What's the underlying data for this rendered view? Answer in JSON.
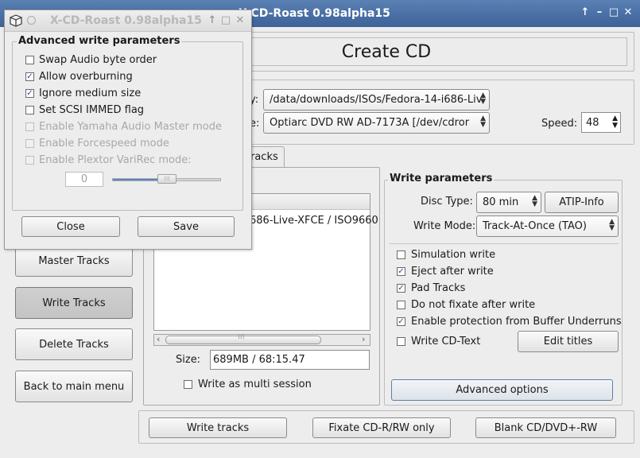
{
  "main_window": {
    "title": "X-CD-Roast 0.98alpha15",
    "controls": [
      "↑",
      "–",
      "□",
      "✕"
    ]
  },
  "header": {
    "title": "Create CD"
  },
  "device": {
    "image_path": "/data/downloads/ISOs/Fedora-14-i686-Liv",
    "image_label_tail": "y:",
    "writer": "Optiarc  DVD RW AD-7173A  [/dev/cdror",
    "writer_label_tail": "e:",
    "speed_label": "Speed:",
    "speed_value": "48"
  },
  "tab": {
    "label_tail": "racks"
  },
  "track_list": {
    "row_text": "686-Live-XFCE / ISO9660",
    "size_label": "Size:",
    "size_value": "689MB / 68:15.47",
    "multi_session_label": "Write as multi session",
    "multi_session_checked": false
  },
  "sidebar": {
    "items": [
      {
        "label": "Master Tracks"
      },
      {
        "label": "Write Tracks"
      },
      {
        "label": "Delete Tracks"
      },
      {
        "label": "Back to main menu"
      }
    ]
  },
  "write_params": {
    "title": "Write parameters",
    "disc_type_label": "Disc Type:",
    "disc_type_value": "80 min",
    "atip_button": "ATIP-Info",
    "write_mode_label": "Write Mode:",
    "write_mode_value": "Track-At-Once (TAO)",
    "options": [
      {
        "label": "Simulation write",
        "checked": false
      },
      {
        "label": "Eject after write",
        "checked": true
      },
      {
        "label": "Pad Tracks",
        "checked": true
      },
      {
        "label": "Do not fixate after write",
        "checked": false
      },
      {
        "label": "Enable protection from Buffer Underruns",
        "checked": true
      },
      {
        "label": "Write CD-Text",
        "checked": false
      }
    ],
    "edit_titles_button": "Edit titles",
    "advanced_button": "Advanced options"
  },
  "bottom_buttons": {
    "write_tracks": "Write tracks",
    "fixate": "Fixate CD-R/RW only",
    "blank": "Blank CD/DVD+-RW"
  },
  "dialog": {
    "title": "X-CD-Roast 0.98alpha15",
    "controls": [
      "↑",
      "□",
      "✕"
    ],
    "section_title": "Advanced write parameters",
    "options": [
      {
        "label": "Swap Audio byte order",
        "checked": false,
        "enabled": true
      },
      {
        "label": "Allow overburning",
        "checked": true,
        "enabled": true
      },
      {
        "label": "Ignore medium size",
        "checked": true,
        "enabled": true
      },
      {
        "label": "Set SCSI IMMED flag",
        "checked": false,
        "enabled": true
      },
      {
        "label": "Enable Yamaha Audio Master mode",
        "checked": false,
        "enabled": false
      },
      {
        "label": "Enable Forcespeed mode",
        "checked": false,
        "enabled": false
      },
      {
        "label": "Enable Plextor VariRec mode:",
        "checked": false,
        "enabled": false
      }
    ],
    "varirec_value": "0",
    "varirec_slider_fraction": 0.5,
    "close_button": "Close",
    "save_button": "Save"
  }
}
